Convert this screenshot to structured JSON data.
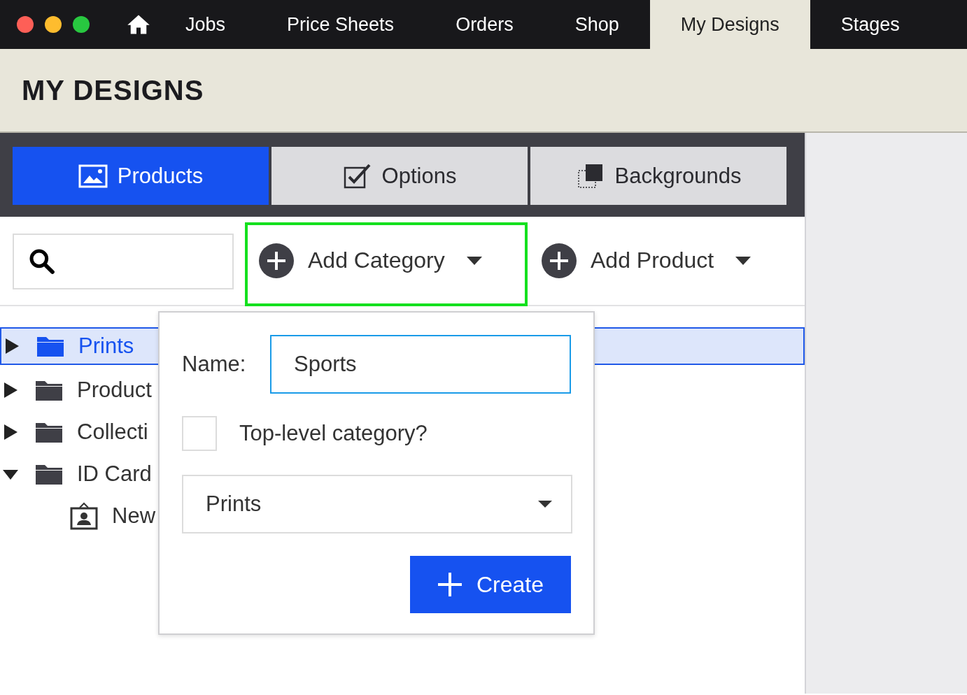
{
  "nav": {
    "items": [
      {
        "label": "Jobs",
        "selected": false
      },
      {
        "label": "Price Sheets",
        "selected": false
      },
      {
        "label": "Orders",
        "selected": false
      },
      {
        "label": "Shop",
        "selected": false
      },
      {
        "label": "My Designs",
        "selected": true
      },
      {
        "label": "Stages",
        "selected": false
      }
    ]
  },
  "page_title": "MY DESIGNS",
  "tabs": [
    {
      "label": "Products",
      "kind": "picture",
      "selected": true
    },
    {
      "label": "Options",
      "kind": "checkbox",
      "selected": false
    },
    {
      "label": "Backgrounds",
      "kind": "layers",
      "selected": false
    }
  ],
  "toolbar": {
    "buttons": [
      {
        "label": "Add Category",
        "focused": true
      },
      {
        "label": "Add Product",
        "focused": false
      }
    ]
  },
  "tree": [
    {
      "label": "Prints",
      "kind": "folder",
      "expanded": false,
      "selected": true
    },
    {
      "label": "Product",
      "kind": "folder",
      "expanded": false,
      "selected": false
    },
    {
      "label": "Collecti",
      "kind": "folder",
      "expanded": false,
      "selected": false
    },
    {
      "label": "ID Card",
      "kind": "folder",
      "expanded": true,
      "selected": false,
      "children": [
        {
          "label": "New",
          "kind": "id-card",
          "selected": false
        }
      ]
    }
  ],
  "popover": {
    "name_label": "Name:",
    "name_value": "Sports",
    "top_level_label": "Top-level category?",
    "top_level_checked": false,
    "parent_value": "Prints",
    "create_button": "Create"
  }
}
